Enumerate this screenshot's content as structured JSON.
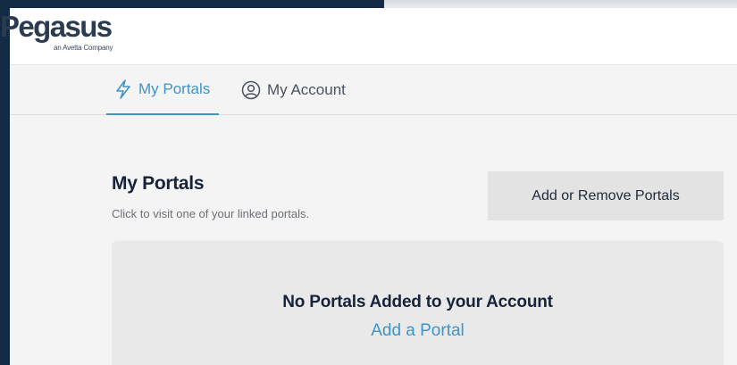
{
  "brand": {
    "name": "Pegasus",
    "tagline": "an Avetta Company"
  },
  "tabs": [
    {
      "label": "My Portals",
      "icon": "lightning-bolt-icon",
      "active": true
    },
    {
      "label": "My Account",
      "icon": "user-circle-icon",
      "active": false
    }
  ],
  "main": {
    "title": "My Portals",
    "subtitle": "Click to visit one of your linked portals.",
    "add_remove_label": "Add or Remove Portals"
  },
  "empty_state": {
    "title": "No Portals Added to your Account",
    "link_label": "Add a Portal"
  },
  "colors": {
    "accent": "#3e95c9",
    "frame": "#132a45",
    "heading": "#17233b",
    "button_bg": "#e3e3e3",
    "card_bg": "#e9e9e9"
  }
}
